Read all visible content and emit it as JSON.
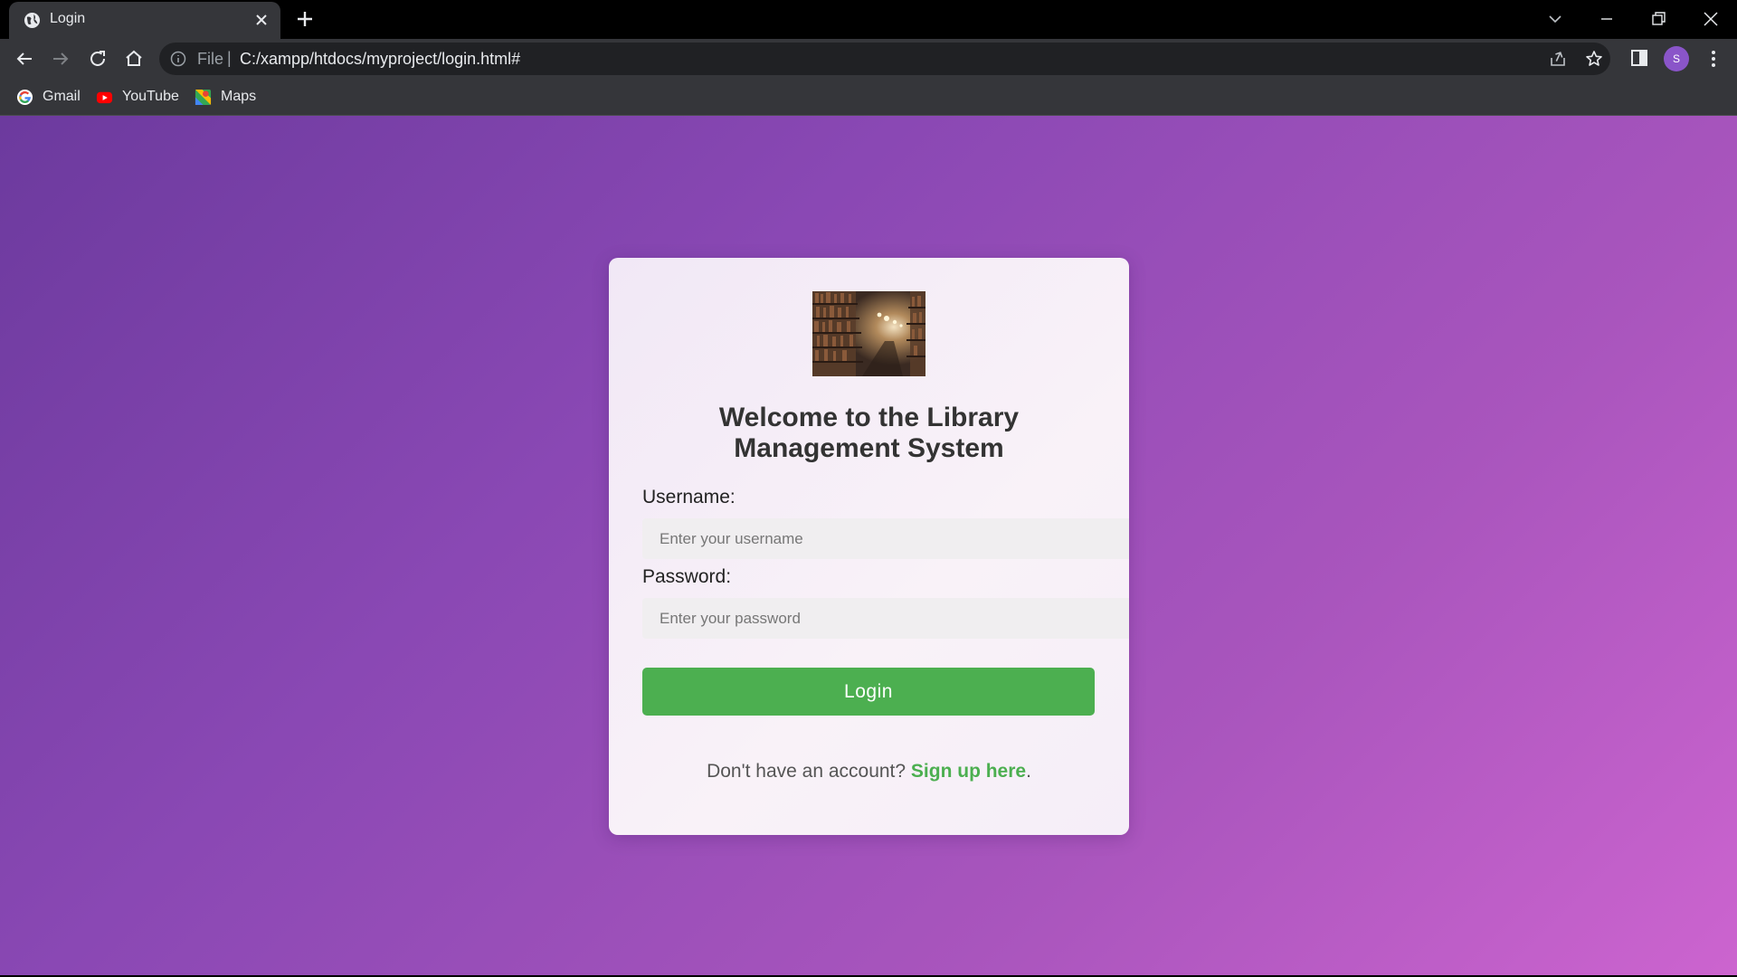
{
  "browser": {
    "tab_title": "Login",
    "omnibox": {
      "scheme_label": "File",
      "separator": "|",
      "url": "C:/xampp/htdocs/myproject/login.html#"
    },
    "profile_initial": "S",
    "bookmarks": [
      {
        "label": "Gmail",
        "icon": "google-icon"
      },
      {
        "label": "YouTube",
        "icon": "youtube-icon"
      },
      {
        "label": "Maps",
        "icon": "maps-icon"
      }
    ]
  },
  "login_form": {
    "logo_alt": "library bookshelves image",
    "title_line1": "Welcome to the Library",
    "title_line2": "Management System",
    "username_label": "Username:",
    "username_placeholder": "Enter your username",
    "username_value": "",
    "password_label": "Password:",
    "password_placeholder": "Enter your password",
    "password_value": "",
    "login_button": "Login",
    "signup_prompt": "Don't have an account?",
    "signup_link": "Sign up here",
    "signup_suffix": "."
  },
  "colors": {
    "accent": "#4caf50",
    "page_gradient_start": "#6c3a9e",
    "page_gradient_end": "#cc64cf",
    "chrome_bg": "#35363a"
  }
}
